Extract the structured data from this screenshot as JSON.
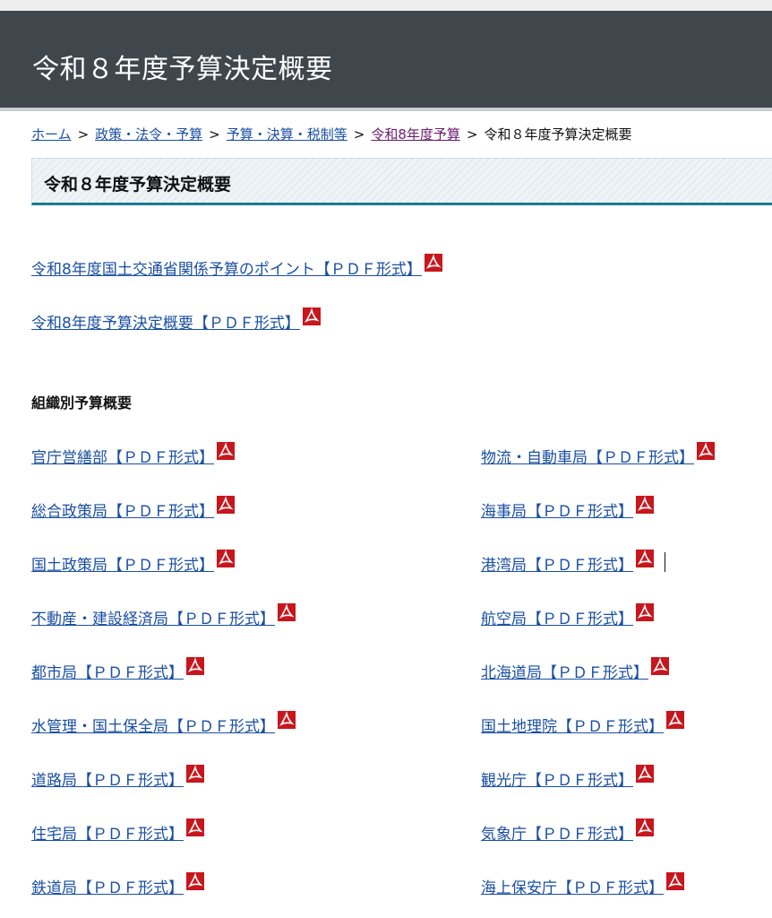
{
  "header": {
    "title": "令和８年度予算決定概要"
  },
  "breadcrumb": {
    "items": [
      "ホーム",
      "政策・法令・予算",
      "予算・決算・税制等",
      "令和8年度予算"
    ],
    "current": "令和８年度予算決定概要",
    "separator": ">"
  },
  "page": {
    "heading": "令和８年度予算決定概要"
  },
  "main_links": [
    "令和8年度国土交通省関係予算のポイント【ＰＤＦ形式】",
    "令和8年度予算決定概要【ＰＤＦ形式】"
  ],
  "section": {
    "title": "組織別予算概要"
  },
  "left_links": [
    "官庁営繕部【ＰＤＦ形式】",
    "総合政策局【ＰＤＦ形式】",
    "国土政策局【ＰＤＦ形式】",
    "不動産・建設経済局【ＰＤＦ形式】",
    "都市局【ＰＤＦ形式】",
    "水管理・国土保全局【ＰＤＦ形式】",
    "道路局【ＰＤＦ形式】",
    "住宅局【ＰＤＦ形式】",
    "鉄道局【ＰＤＦ形式】"
  ],
  "right_links": [
    "物流・自動車局【ＰＤＦ形式】",
    "海事局【ＰＤＦ形式】",
    "港湾局【ＰＤＦ形式】",
    "航空局【ＰＤＦ形式】",
    "北海道局【ＰＤＦ形式】",
    "国土地理院【ＰＤＦ形式】",
    "観光庁【ＰＤＦ形式】",
    "気象庁【ＰＤＦ形式】",
    "海上保安庁【ＰＤＦ形式】"
  ],
  "colors": {
    "header_bg": "#3f474d",
    "link": "#1a4fa3",
    "visited_link": "#6a1b6e",
    "heading_border": "#1a7a99",
    "pdf_red": "#c8161d"
  },
  "icons": {
    "pdf": "pdf-icon"
  }
}
